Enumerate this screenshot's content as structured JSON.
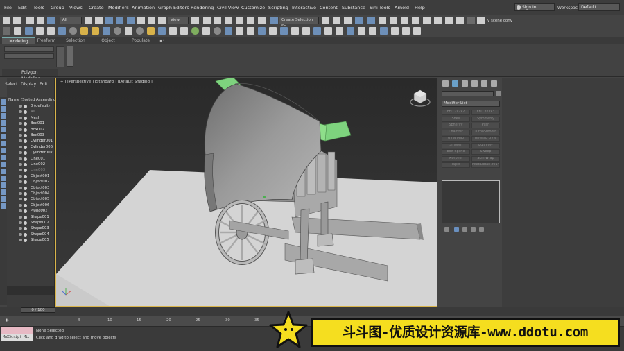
{
  "menubar": {
    "items": [
      "File",
      "Edit",
      "Tools",
      "Group",
      "Views",
      "Create",
      "Modifiers",
      "Animation",
      "Graph Editors",
      "Rendering",
      "Civil View",
      "Customize",
      "Scripting",
      "Interactive",
      "Content",
      "Substance",
      "Sini Tools",
      "Arnold",
      "Help"
    ],
    "signin": "Sign In",
    "workspaces_label": "Workspaces:",
    "workspaces_value": "Default"
  },
  "toolbar": {
    "selection_filter": "All",
    "ref_coord": "View",
    "named_selection": "Create Selection Se",
    "scene_label": "y scene conv"
  },
  "ribbon": {
    "tabs": [
      "Modeling",
      "Freeform",
      "Selection",
      "Object Paint",
      "Populate"
    ],
    "active_tab": "Modeling",
    "panel_label": "Polygon Modeling"
  },
  "scene_explorer": {
    "menu": [
      "Select",
      "Display",
      "Edit"
    ],
    "header": "Name (Sorted Ascending)",
    "rows": [
      {
        "label": "0 (default)",
        "state": "normal"
      },
      {
        "label": "Ali",
        "state": "dim"
      },
      {
        "label": "Mesh",
        "state": "normal"
      },
      {
        "label": "Box001",
        "state": "normal"
      },
      {
        "label": "Box002",
        "state": "normal"
      },
      {
        "label": "Box003",
        "state": "normal"
      },
      {
        "label": "Cylinder001",
        "state": "normal"
      },
      {
        "label": "Cylinder006",
        "state": "normal"
      },
      {
        "label": "Cylinder007",
        "state": "normal"
      },
      {
        "label": "Line001",
        "state": "normal"
      },
      {
        "label": "Line002",
        "state": "normal"
      },
      {
        "label": "Line003",
        "state": "dim"
      },
      {
        "label": "Object001",
        "state": "normal"
      },
      {
        "label": "Object002",
        "state": "normal"
      },
      {
        "label": "Object003",
        "state": "normal"
      },
      {
        "label": "Object004",
        "state": "normal"
      },
      {
        "label": "Object005",
        "state": "normal"
      },
      {
        "label": "Object006",
        "state": "normal"
      },
      {
        "label": "Plane001",
        "state": "italic"
      },
      {
        "label": "Shape001",
        "state": "normal"
      },
      {
        "label": "Shape002",
        "state": "normal"
      },
      {
        "label": "Shape003",
        "state": "normal"
      },
      {
        "label": "Shape004",
        "state": "normal"
      },
      {
        "label": "Shape005",
        "state": "normal"
      }
    ]
  },
  "viewport": {
    "label": "[ + ] [Perspective ] [Standard ] [Default Shading ]",
    "highlight_color": "#d9b44a",
    "object_color": "#9c9c9c",
    "pole_color": "#7ed37e"
  },
  "command_panel": {
    "modifier_list": "Modifier List",
    "modifiers": [
      "FFD 2x2x2",
      "FFD 3x3x3",
      "Shell",
      "Symmetry",
      "Spherify",
      "Push",
      "Chamfer",
      "TurboSmooth",
      "UVW Map",
      "Unwrap UVW",
      "Smooth",
      "Edit Poly",
      "Edit Spline",
      "Sweep",
      "Morpher",
      "Skin Wrap",
      "Taper",
      "MultiDetail 2014"
    ]
  },
  "timeline": {
    "slider": "0 / 100",
    "ticks": [
      "5",
      "10",
      "15",
      "20",
      "25",
      "30",
      "35",
      "40"
    ]
  },
  "status": {
    "maxscript": "MAXScript Mi:",
    "line1": "None Selected",
    "line2": "Click and drag to select and move objects"
  },
  "watermark": {
    "text": "斗斗图-优质设计资源库-www.ddotu.com",
    "color": "#f5de1f"
  }
}
